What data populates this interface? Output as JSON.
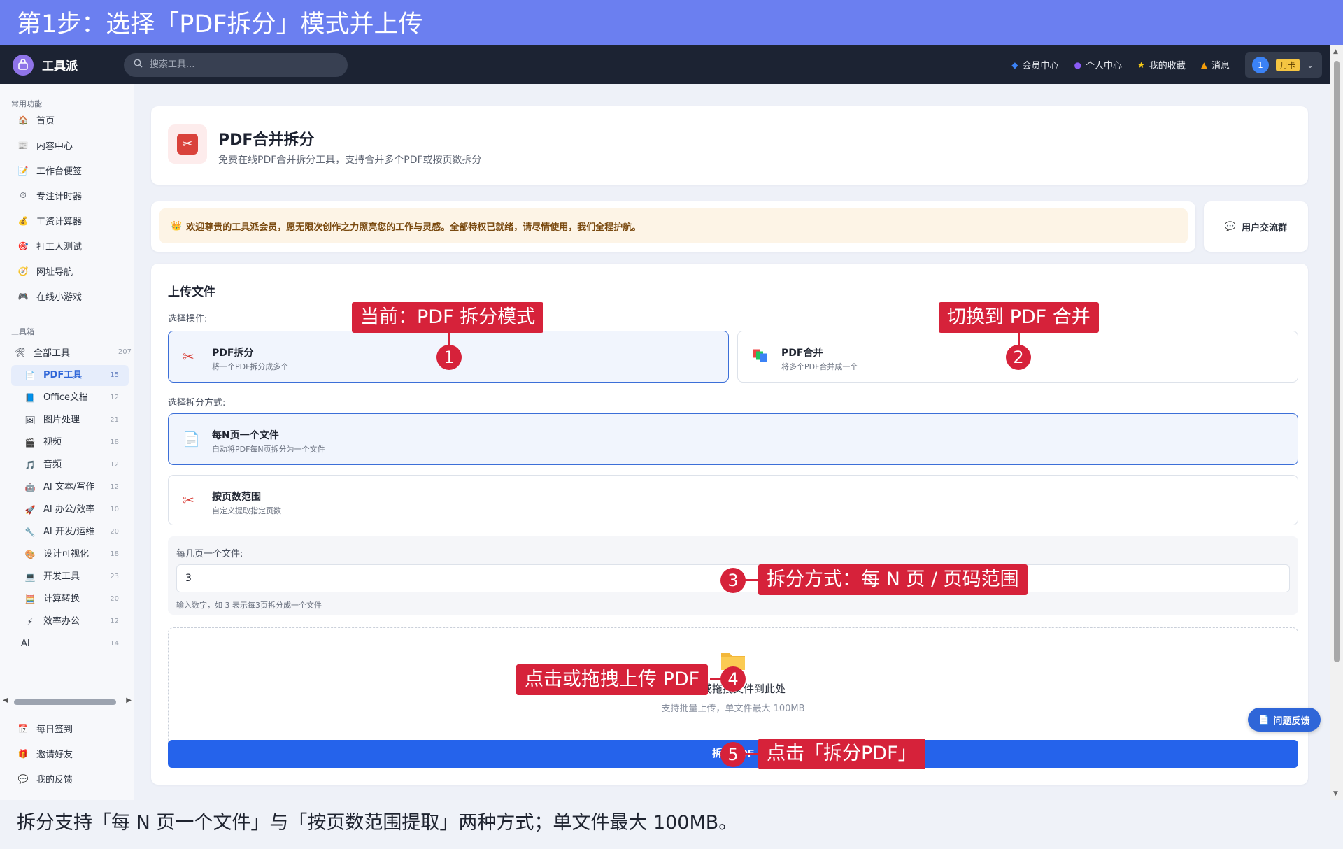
{
  "tutorial": {
    "title": "第1步：选择「PDF拆分」模式并上传",
    "caption": "拆分支持「每 N 页一个文件」与「按页数范围提取」两种方式；单文件最大 100MB。",
    "annotations": [
      {
        "num": "1",
        "text": "当前：PDF 拆分模式"
      },
      {
        "num": "2",
        "text": "切换到 PDF 合并"
      },
      {
        "num": "3",
        "text": "拆分方式：每 N 页 / 页码范围"
      },
      {
        "num": "4",
        "text": "点击或拖拽上传 PDF"
      },
      {
        "num": "5",
        "text": "点击「拆分PDF」"
      }
    ]
  },
  "navbar": {
    "logo_text": "工具派",
    "search_placeholder": "搜索工具...",
    "links": [
      {
        "label": "会员中心",
        "icon": "diamond-icon",
        "color": "#3b82f6"
      },
      {
        "label": "个人中心",
        "icon": "user-icon",
        "color": "#8b5cf6"
      },
      {
        "label": "我的收藏",
        "icon": "star-icon",
        "color": "#facc15"
      },
      {
        "label": "消息",
        "icon": "bell-icon",
        "color": "#f59e0b"
      }
    ],
    "user_avatar": "1",
    "user_badge": "月卡"
  },
  "sidebar": {
    "section_common": "常用功能",
    "common_items": [
      {
        "label": "首页",
        "icon": "🏠"
      },
      {
        "label": "内容中心",
        "icon": "📰"
      },
      {
        "label": "工作台便签",
        "icon": "📝"
      },
      {
        "label": "专注计时器",
        "icon": "⏱"
      },
      {
        "label": "工资计算器",
        "icon": "💰"
      },
      {
        "label": "打工人测试",
        "icon": "🎯"
      },
      {
        "label": "网址导航",
        "icon": "🧭"
      },
      {
        "label": "在线小游戏",
        "icon": "🎮"
      }
    ],
    "section_tools": "工具箱",
    "all_tools": {
      "label": "全部工具",
      "count": "207"
    },
    "tool_items": [
      {
        "label": "PDF工具",
        "count": "15",
        "icon": "📄"
      },
      {
        "label": "Office文档",
        "count": "12",
        "icon": "📘"
      },
      {
        "label": "图片处理",
        "count": "21",
        "icon": "🖼"
      },
      {
        "label": "视频",
        "count": "18",
        "icon": "🎬"
      },
      {
        "label": "音频",
        "count": "12",
        "icon": "🎵"
      },
      {
        "label": "AI 文本/写作",
        "count": "12",
        "icon": "🤖"
      },
      {
        "label": "AI 办公/效率",
        "count": "10",
        "icon": "🚀"
      },
      {
        "label": "AI 开发/运维",
        "count": "20",
        "icon": "🔧"
      },
      {
        "label": "设计可视化",
        "count": "18",
        "icon": "🎨"
      },
      {
        "label": "开发工具",
        "count": "23",
        "icon": "💻"
      },
      {
        "label": "计算转换",
        "count": "20",
        "icon": "🧮"
      },
      {
        "label": "效率办公",
        "count": "12",
        "icon": "⚡"
      },
      {
        "label": "AI",
        "count": "14",
        "icon": ""
      }
    ],
    "bottom_items": [
      {
        "label": "每日签到",
        "icon": "📅"
      },
      {
        "label": "邀请好友",
        "icon": "🎁"
      },
      {
        "label": "我的反馈",
        "icon": "💬"
      }
    ]
  },
  "header": {
    "title": "PDF合并拆分",
    "desc": "免费在线PDF合并拆分工具，支持合并多个PDF或按页数拆分"
  },
  "notice": {
    "text": "欢迎尊贵的工具派会员，愿无限次创作之力照亮您的工作与灵感。全部特权已就绪，请尽情使用，我们全程护航。",
    "group_label": "用户交流群"
  },
  "upload": {
    "section_title": "上传文件",
    "op_label": "选择操作:",
    "ops": [
      {
        "title": "PDF拆分",
        "sub": "将一个PDF拆分成多个"
      },
      {
        "title": "PDF合并",
        "sub": "将多个PDF合并成一个"
      }
    ],
    "mode_label": "选择拆分方式:",
    "modes": [
      {
        "title": "每N页一个文件",
        "sub": "自动将PDF每N页拆分为一个文件"
      },
      {
        "title": "按页数范围",
        "sub": "自定义提取指定页数"
      }
    ],
    "n_label": "每几页一个文件:",
    "n_value": "3",
    "n_hint": "输入数字，如 3 表示每3页拆分成一个文件",
    "drop_main": "点击或拖拽文件到此处",
    "drop_sub": "支持批量上传，单文件最大 100MB",
    "split_button": "拆分PDF",
    "feedback": "问题反馈"
  }
}
